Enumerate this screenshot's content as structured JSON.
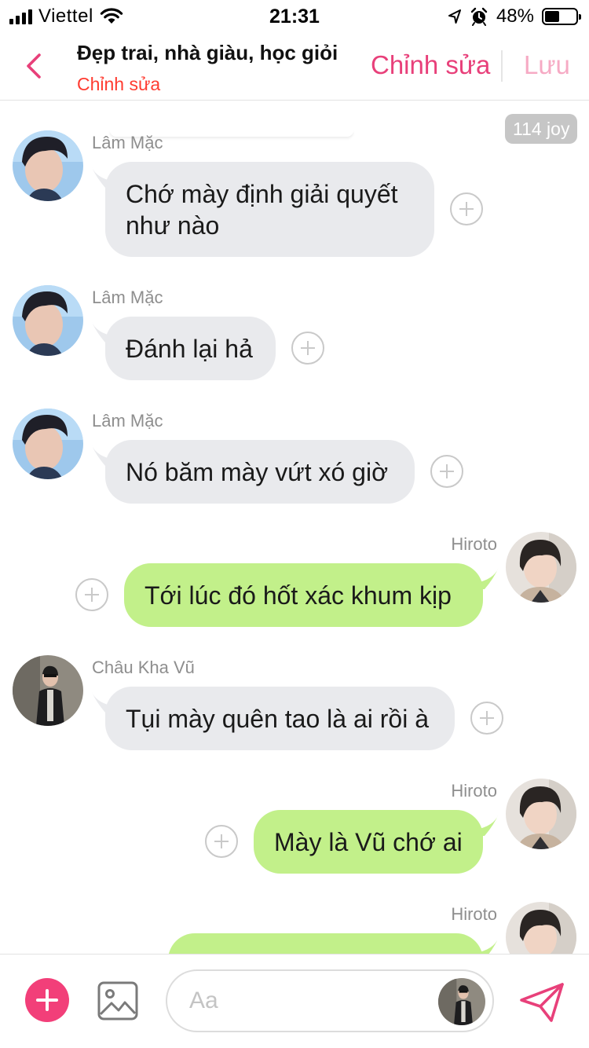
{
  "status_bar": {
    "carrier": "Viettel",
    "time": "21:31",
    "battery_text": "48%",
    "battery_level": 0.48
  },
  "header": {
    "title": "Đẹp trai, nhà giàu, học giỏi",
    "subtitle": "Chỉnh sửa",
    "edit_label": "Chỉnh sửa",
    "save_label": "Lưu",
    "accent_color": "#e8407a",
    "subtitle_color": "#ff3b30"
  },
  "chat": {
    "joy_badge": "114 joy",
    "messages": [
      {
        "sender": "Lâm Mặc",
        "direction": "in",
        "lines": [
          "Chớ mày định giải quyết",
          "như nào"
        ]
      },
      {
        "sender": "Lâm Mặc",
        "direction": "in",
        "lines": [
          "Đánh lại hả"
        ]
      },
      {
        "sender": "Lâm Mặc",
        "direction": "in",
        "lines": [
          "Nó băm mày vứt xó giờ"
        ]
      },
      {
        "sender": "Hiroto",
        "direction": "out",
        "lines": [
          "Tới lúc đó hốt xác khum kịp"
        ]
      },
      {
        "sender": "Châu Kha Vũ",
        "direction": "in",
        "lines": [
          "Tụi mày quên tao là ai rồi à"
        ]
      },
      {
        "sender": "Hiroto",
        "direction": "out",
        "lines": [
          "Mày là Vũ chớ ai"
        ]
      },
      {
        "sender": "Hiroto",
        "direction": "out",
        "lines": []
      }
    ]
  },
  "composer": {
    "placeholder": "Aa"
  },
  "colors": {
    "incoming_bubble": "#e9eaed",
    "outgoing_bubble": "#c2f08a",
    "add_button": "#f23f79",
    "send_icon": "#e8407a"
  },
  "icons": [
    "back-chevron-icon",
    "plus-circle-icon",
    "image-icon",
    "send-icon",
    "wifi-icon",
    "location-arrow-icon",
    "alarm-icon"
  ]
}
